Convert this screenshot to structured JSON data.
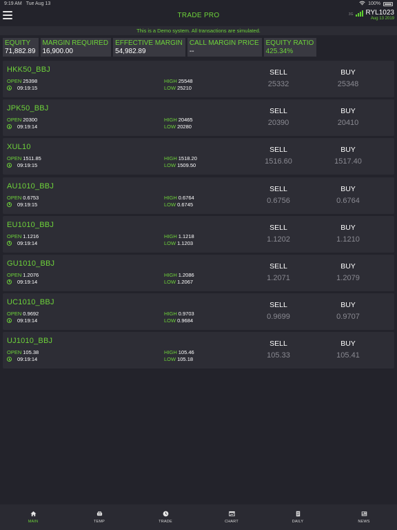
{
  "status_bar": {
    "time": "9:19 AM",
    "date": "Tue Aug 13",
    "battery": "100%"
  },
  "header": {
    "title": "TRADE PRO",
    "account_id": "RYL1023",
    "account_date": "Aug 13 2019",
    "account_prefix": "3G"
  },
  "banner": "This is a Demo system. All transactions are simulated.",
  "stats": [
    {
      "label": "EQUITY",
      "value": "71,882.89"
    },
    {
      "label": "MARGIN REQUIRED",
      "value": "16,900.00"
    },
    {
      "label": "EFFECTIVE MARGIN",
      "value": "54,982.89"
    },
    {
      "label": "CALL MARGIN PRICE",
      "value": "--"
    },
    {
      "label": "EQUITY RATIO",
      "value": "425.34%"
    }
  ],
  "labels": {
    "open": "OPEN",
    "high": "HIGH",
    "low": "LOW",
    "sell": "SELL",
    "buy": "BUY"
  },
  "quotes": [
    {
      "symbol": "HKK50_BBJ",
      "open": "25398",
      "time": "09:19:15",
      "high": "25548",
      "low": "25210",
      "sell": "25332",
      "buy": "25348"
    },
    {
      "symbol": "JPK50_BBJ",
      "open": "20300",
      "time": "09:19:14",
      "high": "20465",
      "low": "20280",
      "sell": "20390",
      "buy": "20410"
    },
    {
      "symbol": "XUL10",
      "open": "1511.85",
      "time": "09:19:15",
      "high": "1518.20",
      "low": "1509.50",
      "sell": "1516.60",
      "buy": "1517.40"
    },
    {
      "symbol": "AU1010_BBJ",
      "open": "0.6753",
      "time": "09:19:15",
      "high": "0.6764",
      "low": "0.6745",
      "sell": "0.6756",
      "buy": "0.6764"
    },
    {
      "symbol": "EU1010_BBJ",
      "open": "1.1216",
      "time": "09:19:14",
      "high": "1.1218",
      "low": "1.1203",
      "sell": "1.1202",
      "buy": "1.1210"
    },
    {
      "symbol": "GU1010_BBJ",
      "open": "1.2076",
      "time": "09:19:14",
      "high": "1.2086",
      "low": "1.2067",
      "sell": "1.2071",
      "buy": "1.2079"
    },
    {
      "symbol": "UC1010_BBJ",
      "open": "0.9692",
      "time": "09:19:14",
      "high": "0.9703",
      "low": "0.9684",
      "sell": "0.9699",
      "buy": "0.9707"
    },
    {
      "symbol": "UJ1010_BBJ",
      "open": "105.38",
      "time": "09:19:14",
      "high": "105.46",
      "low": "105.18",
      "sell": "105.33",
      "buy": "105.41"
    }
  ],
  "tabs": [
    {
      "label": "MAIN",
      "icon": "home-icon",
      "active": true
    },
    {
      "label": "TEMP",
      "icon": "temp-icon",
      "active": false
    },
    {
      "label": "TRADE",
      "icon": "clock-icon",
      "active": false
    },
    {
      "label": "CHART",
      "icon": "chart-icon",
      "active": false
    },
    {
      "label": "DAILY",
      "icon": "document-icon",
      "active": false
    },
    {
      "label": "NEWS",
      "icon": "newspaper-icon",
      "active": false
    }
  ],
  "colors": {
    "accent": "#6ed33a",
    "background": "#23232b",
    "card": "#2d2d35",
    "price": "#8a8a92"
  }
}
